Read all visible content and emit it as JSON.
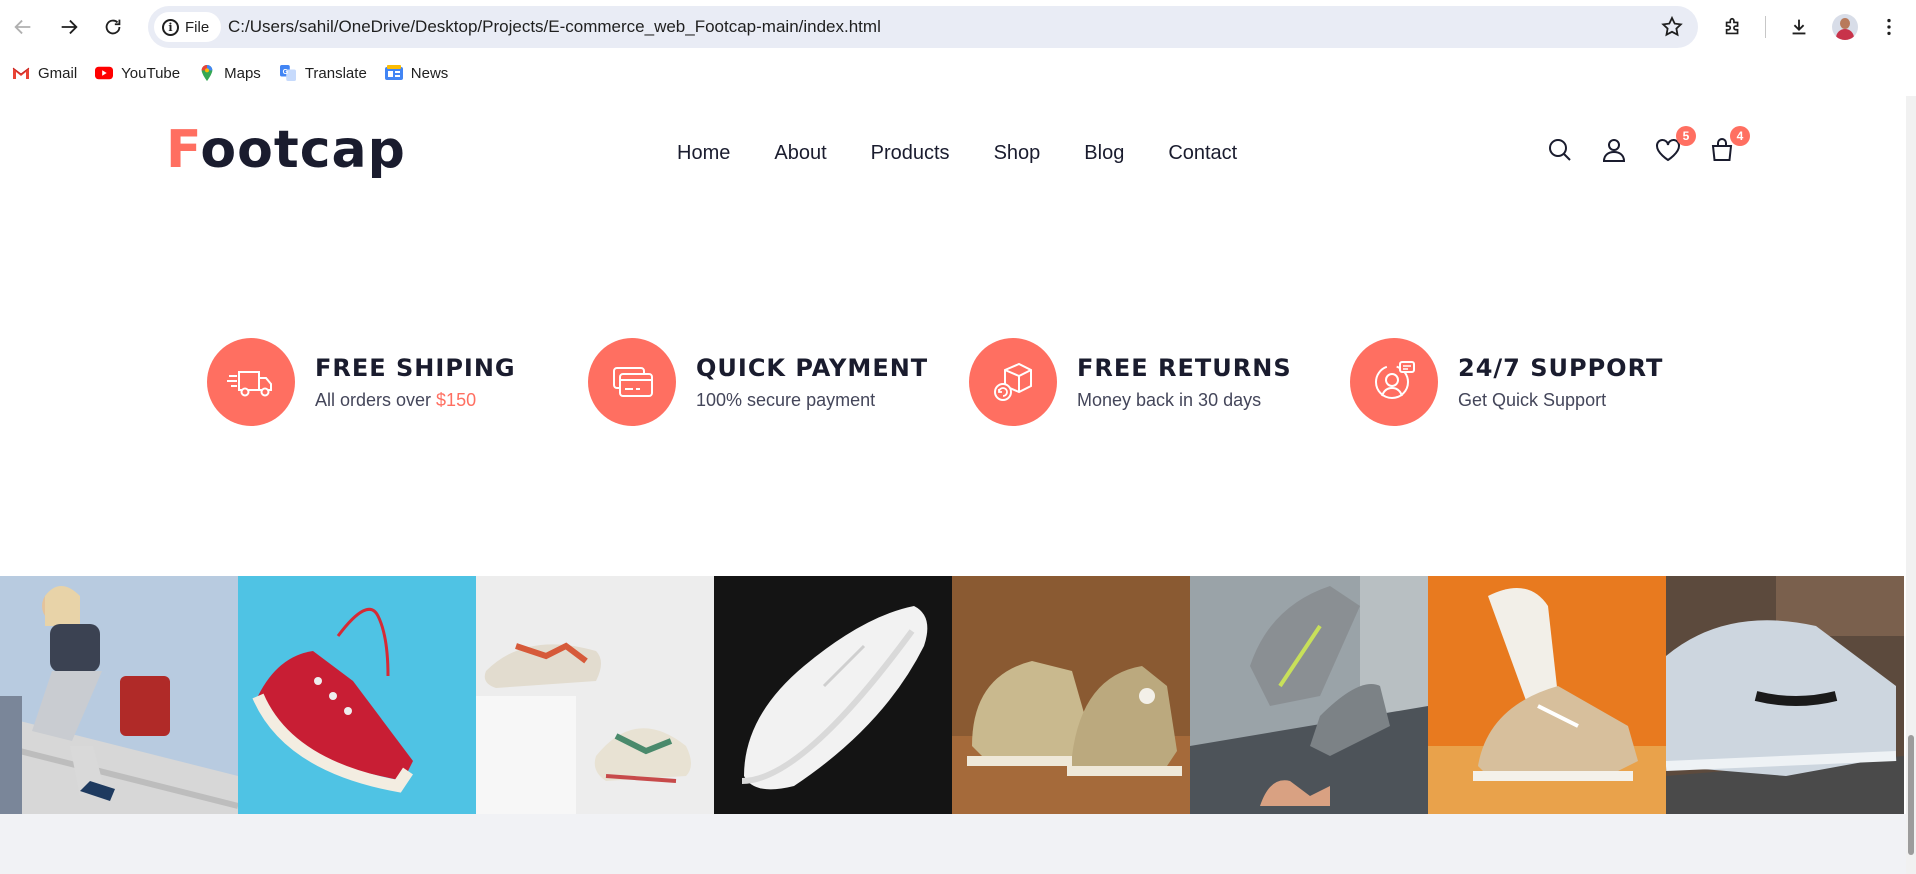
{
  "browser": {
    "file_chip_label": "File",
    "url": "C:/Users/sahil/OneDrive/Desktop/Projects/E-commerce_web_Footcap-main/index.html",
    "icons": [
      "back-icon",
      "forward-icon",
      "reload-icon",
      "info-icon",
      "star-icon",
      "extensions-icon",
      "download-icon",
      "profile-avatar",
      "menu-icon"
    ]
  },
  "bookmarks": [
    {
      "label": "Gmail",
      "icon": "gmail-icon"
    },
    {
      "label": "YouTube",
      "icon": "youtube-icon"
    },
    {
      "label": "Maps",
      "icon": "maps-icon"
    },
    {
      "label": "Translate",
      "icon": "translate-icon"
    },
    {
      "label": "News",
      "icon": "news-icon"
    }
  ],
  "site": {
    "logo_first": "F",
    "logo_rest": "ootcap",
    "nav": [
      "Home",
      "About",
      "Products",
      "Shop",
      "Blog",
      "Contact"
    ],
    "wishlist_count": "5",
    "cart_count": "4"
  },
  "services": [
    {
      "title": "FREE SHIPING",
      "sub_prefix": "All orders over ",
      "sub_accent": "$150",
      "icon": "delivery-truck-icon"
    },
    {
      "title": "QUICK PAYMENT",
      "sub_prefix": "100% secure payment",
      "sub_accent": "",
      "icon": "credit-card-icon"
    },
    {
      "title": "FREE RETURNS",
      "sub_prefix": "Money back in 30 days",
      "sub_accent": "",
      "icon": "return-box-icon"
    },
    {
      "title": "24/7 SUPPORT",
      "sub_prefix": "Get Quick Support",
      "sub_accent": "",
      "icon": "support-agent-icon"
    }
  ],
  "colors": {
    "accent": "#ff6f61",
    "dark": "#1a1c2e",
    "body": "#44465a"
  }
}
